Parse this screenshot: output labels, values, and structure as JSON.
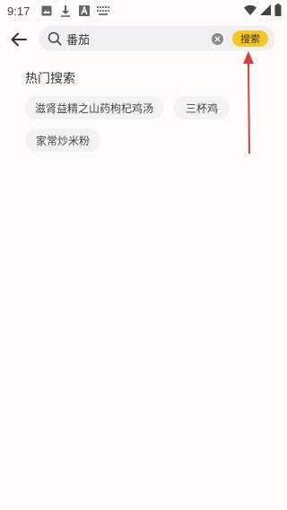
{
  "status_bar": {
    "time": "9:17",
    "left_icons": [
      "image-icon",
      "download-icon",
      "font-a-icon",
      "keyboard-icon"
    ],
    "right_icons": [
      "wifi-icon",
      "signal-icon",
      "battery-icon"
    ]
  },
  "header": {
    "back_icon": "arrow-left-icon",
    "search": {
      "value": "番茄",
      "clear_icon": "clear-circle-icon",
      "button_label": "搜索",
      "button_color": "#f6c622"
    }
  },
  "hot_search": {
    "title": "热门搜索",
    "tags": [
      "滋肾益精之山药枸杞鸡汤",
      "三杯鸡",
      "家常炒米粉"
    ]
  },
  "annotation": {
    "arrow_color": "#d9413f"
  }
}
